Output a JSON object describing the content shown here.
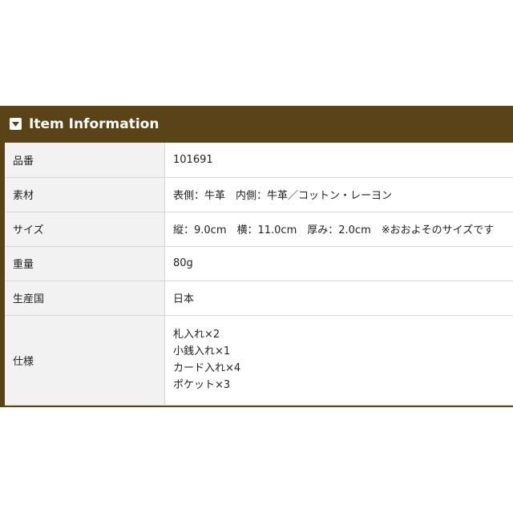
{
  "header": {
    "title": "Item Information",
    "icon": "chevron-down-icon"
  },
  "rows": [
    {
      "label": "品番",
      "value": "101691"
    },
    {
      "label": "素材",
      "value": "表側：牛革　内側：牛革／コットン・レーヨン"
    },
    {
      "label": "サイズ",
      "value": "縦：9.0cm　横：11.0cm　厚み：2.0cm　※おおよそのサイズです"
    },
    {
      "label": "重量",
      "value": "80g"
    },
    {
      "label": "生産国",
      "value": "日本"
    }
  ],
  "spec": {
    "label": "仕様",
    "lines": [
      "札入れ×2",
      "小銭入れ×1",
      "カード入れ×4",
      "ポケット×3"
    ]
  },
  "colors": {
    "header_bg": "#5a4317",
    "label_bg": "#f2f2f2"
  }
}
